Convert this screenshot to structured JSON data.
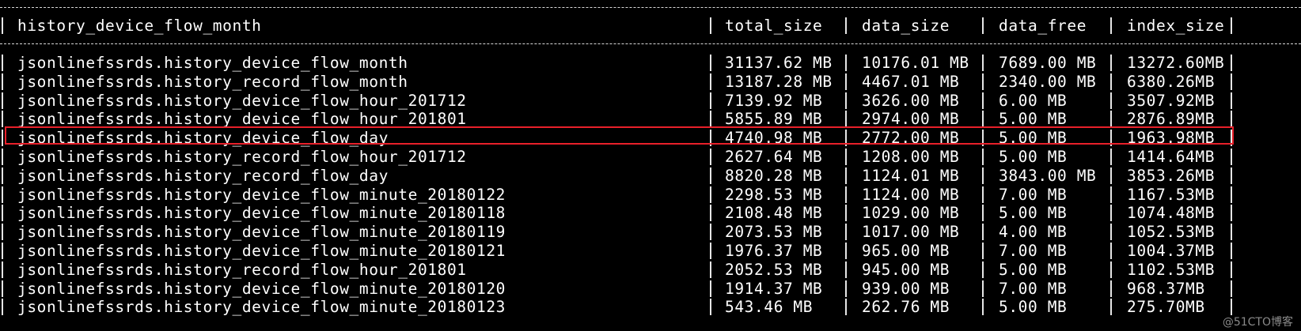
{
  "terminal": {
    "columns": [
      "history_device_flow_month",
      "total_size",
      "data_size",
      "data_free",
      "index_size"
    ],
    "rows": [
      {
        "name": "jsonlinefssrds.history_device_flow_month",
        "total_size": "31137.62 MB",
        "data_size": "10176.01 MB",
        "data_free": "7689.00 MB",
        "index_size": "13272.60MB"
      },
      {
        "name": "jsonlinefssrds.history_record_flow_month",
        "total_size": "13187.28 MB",
        "data_size": "4467.01 MB",
        "data_free": "2340.00 MB",
        "index_size": "6380.26MB"
      },
      {
        "name": "jsonlinefssrds.history_device_flow_hour_201712",
        "total_size": "7139.92 MB",
        "data_size": "3626.00 MB",
        "data_free": "6.00 MB",
        "index_size": "3507.92MB"
      },
      {
        "name": "jsonlinefssrds.history_device_flow_hour_201801",
        "total_size": "5855.89 MB",
        "data_size": "2974.00 MB",
        "data_free": "5.00 MB",
        "index_size": "2876.89MB"
      },
      {
        "name": "jsonlinefssrds.history_device_flow_day",
        "total_size": "4740.98 MB",
        "data_size": "2772.00 MB",
        "data_free": "5.00 MB",
        "index_size": "1963.98MB"
      },
      {
        "name": "jsonlinefssrds.history_record_flow_hour_201712",
        "total_size": "2627.64 MB",
        "data_size": "1208.00 MB",
        "data_free": "5.00 MB",
        "index_size": "1414.64MB"
      },
      {
        "name": "jsonlinefssrds.history_record_flow_day",
        "total_size": "8820.28 MB",
        "data_size": "1124.01 MB",
        "data_free": "3843.00 MB",
        "index_size": "3853.26MB"
      },
      {
        "name": "jsonlinefssrds.history_device_flow_minute_20180122",
        "total_size": "2298.53 MB",
        "data_size": "1124.00 MB",
        "data_free": "7.00 MB",
        "index_size": "1167.53MB"
      },
      {
        "name": "jsonlinefssrds.history_device_flow_minute_20180118",
        "total_size": "2108.48 MB",
        "data_size": "1029.00 MB",
        "data_free": "5.00 MB",
        "index_size": "1074.48MB"
      },
      {
        "name": "jsonlinefssrds.history_device_flow_minute_20180119",
        "total_size": "2073.53 MB",
        "data_size": "1017.00 MB",
        "data_free": "4.00 MB",
        "index_size": "1052.53MB"
      },
      {
        "name": "jsonlinefssrds.history_device_flow_minute_20180121",
        "total_size": "1976.37 MB",
        "data_size": "965.00 MB",
        "data_free": "7.00 MB",
        "index_size": "1004.37MB"
      },
      {
        "name": "jsonlinefssrds.history_record_flow_hour_201801",
        "total_size": "2052.53 MB",
        "data_size": "945.00 MB",
        "data_free": "5.00 MB",
        "index_size": "1102.53MB"
      },
      {
        "name": "jsonlinefssrds.history_device_flow_minute_20180120",
        "total_size": "1914.37 MB",
        "data_size": "939.00 MB",
        "data_free": "7.00 MB",
        "index_size": "968.37MB"
      },
      {
        "name": "jsonlinefssrds.history_device_flow_minute_20180123",
        "total_size": "543.46 MB",
        "data_size": "262.76 MB",
        "data_free": "5.00 MB",
        "index_size": "275.70MB"
      }
    ],
    "highlighted_row": 4,
    "colors": {
      "background": "#000000",
      "text": "#ffffff",
      "highlight": "#e8202a"
    }
  },
  "watermark": "@51CTO博客"
}
